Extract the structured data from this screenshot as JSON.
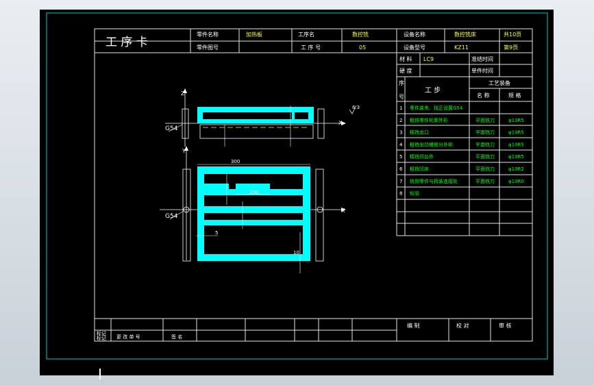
{
  "header": {
    "title": "工 序 卡",
    "part_name_label": "零件名称",
    "part_name_value": "加热板",
    "process_name_label": "工序名",
    "process_name_value": "数控铣",
    "equipment_name_label": "设备名称",
    "equipment_name_value": "数控铣床",
    "total_pages": "共10页",
    "part_number_label": "零件图号",
    "process_no_label": "工 序 号",
    "process_no_value": "05",
    "equipment_model_label": "设备型号",
    "equipment_model_value": "KZ11",
    "page_no": "第9页"
  },
  "info": {
    "material_label": "材 料",
    "material_value": "LC9",
    "prep_time_label": "准结时间",
    "hardness_label": "硬 度",
    "unit_time_label": "单件时间"
  },
  "steps_header": {
    "seq_label_top": "序",
    "seq_label_bottom": "号",
    "step_label": "工 步",
    "equipment_label": "工艺装备",
    "name_label": "名 称",
    "spec_label": "规 格"
  },
  "steps": [
    {
      "no": "1",
      "desc": "零件装夹、找正设置G54",
      "tool": "",
      "spec": ""
    },
    {
      "no": "2",
      "desc": "粗铣零件轮廓外形",
      "tool": "平面铣刀",
      "spec": "φ10R5"
    },
    {
      "no": "3",
      "desc": "精铣出口",
      "tool": "平面铣刀",
      "spec": "φ10R5"
    },
    {
      "no": "4",
      "desc": "粗铣出凹槽部分外轮",
      "tool": "平面铣刀",
      "spec": "φ10R5"
    },
    {
      "no": "5",
      "desc": "精铣凹台外",
      "tool": "平面铣刀",
      "spec": "φ10R5"
    },
    {
      "no": "6",
      "desc": "粗铣凹床",
      "tool": "平面铣刀",
      "spec": "φ10R2"
    },
    {
      "no": "7",
      "desc": "铣侧零件与拆装连接处",
      "tool": "平面铣刀",
      "spec": "φ10R0"
    },
    {
      "no": "8",
      "desc": "检验",
      "tool": "",
      "spec": ""
    }
  ],
  "footer": {
    "mark_label": "标记",
    "zone_label": "标记",
    "change_doc_label": "更 改 单 号",
    "sign_label": "签 名",
    "compile_label": "编 制",
    "proofread_label": "校 对",
    "review_label": "审 核"
  },
  "annotations": {
    "g54_top": "G54",
    "g54_bottom": "G54",
    "axis_x_top": "X",
    "axis_z_top": "Z",
    "axis_x_bottom": "X",
    "axis_y_bottom": "Y",
    "dim_top_width": "300",
    "dim_slot_width": "100",
    "dim_side_5": "5",
    "dim_small_10": "10",
    "roughness": "6.3"
  },
  "colors": {
    "border": "#00c8c8",
    "table_line": "#e6e6e6",
    "header_text": "#ffffff",
    "value_text": "#ffff33",
    "step_text": "#00ff00",
    "part_fill": "#00ffff",
    "dim_line": "#ffffff",
    "cut_line": "#ffff00"
  }
}
